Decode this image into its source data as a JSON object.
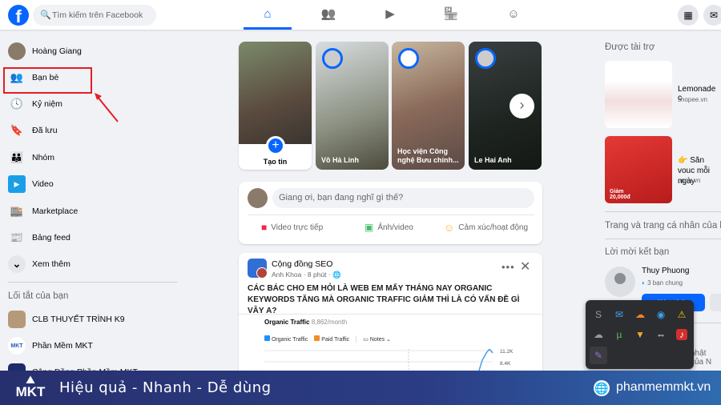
{
  "header": {
    "logo": "f",
    "search_placeholder": "Tìm kiếm trên Facebook",
    "nav": [
      {
        "icon": "home-icon",
        "glyph": "⌂",
        "active": true
      },
      {
        "icon": "friends-icon",
        "glyph": "👥"
      },
      {
        "icon": "watch-icon",
        "glyph": "▶"
      },
      {
        "icon": "marketplace-icon",
        "glyph": "🏪"
      },
      {
        "icon": "groups-icon",
        "glyph": "☺"
      }
    ],
    "menu_icon": "▦",
    "messenger_icon": "✉"
  },
  "sidebar": {
    "items": [
      {
        "label": "Hoàng Giang",
        "icon": "avatar"
      },
      {
        "label": "Bạn bè",
        "icon": "friends-icon",
        "glyph": "👥",
        "highlighted": true
      },
      {
        "label": "Kỷ niệm",
        "icon": "memories-icon",
        "glyph": "🕓"
      },
      {
        "label": "Đã lưu",
        "icon": "saved-icon",
        "glyph": "🔖"
      },
      {
        "label": "Nhóm",
        "icon": "groups-icon",
        "glyph": "👪"
      },
      {
        "label": "Video",
        "icon": "video-icon",
        "glyph": "▶"
      },
      {
        "label": "Marketplace",
        "icon": "marketplace-icon",
        "glyph": "🏬"
      },
      {
        "label": "Bảng feed",
        "icon": "feeds-icon",
        "glyph": "📰"
      },
      {
        "label": "Xem thêm",
        "icon": "chevron-down-icon",
        "glyph": "⌄"
      }
    ],
    "shortcuts_title": "Lối tắt của bạn",
    "shortcuts": [
      {
        "label": "CLB THUYẾT TRÌNH K9"
      },
      {
        "label": "Phần Mềm MKT"
      },
      {
        "label": "Cộng Đồng Phần Mềm MKT"
      }
    ]
  },
  "stories": [
    {
      "label": "Tạo tin"
    },
    {
      "label": "Võ Hà Linh"
    },
    {
      "label": "Học viện Công nghệ Bưu chính..."
    },
    {
      "label": "Le Hai Anh"
    }
  ],
  "composer": {
    "placeholder": "Giang ơi, bạn đang nghĩ gì thế?",
    "actions": [
      {
        "label": "Video trực tiếp",
        "color": "#f02849"
      },
      {
        "label": "Ảnh/video",
        "color": "#45bd62"
      },
      {
        "label": "Cảm xúc/hoạt động",
        "color": "#f7b928"
      }
    ]
  },
  "post": {
    "group": "Cộng đồng SEO",
    "author": "Anh Khoa",
    "time": "8 phút",
    "text": "CÁC BÁC CHO EM HỎI LÀ WEB EM MẤY THÁNG NAY ORGANIC KEYWORDS TĂNG MÀ ORGANIC TRAFFIC GIẢM THÌ LÀ CÓ VẤN ĐỀ GÌ VẬY Ạ?",
    "chart_title": "Organic Traffic",
    "chart_value": "8,862/month",
    "legend": [
      "Organic Traffic",
      "Paid Traffic"
    ],
    "notes": "Notes",
    "ticks": [
      "11.2K",
      "8.4K"
    ]
  },
  "right": {
    "sponsored": "Được tài trợ",
    "ads": [
      {
        "title": "Lemonade c",
        "domain": "shopee.vn"
      },
      {
        "title": "👉 Săn vouc mỗi ngày",
        "domain": "oneu.vn",
        "image_text": "Giảm 20,000đ"
      }
    ],
    "pages_title": "Trang và trang cá nhân của ba",
    "requests_title": "Lời mời kết bạn",
    "request": {
      "name": "Thuy Phuong",
      "mutual": "3 bạn chung",
      "confirm": "Xác nhận"
    },
    "birthday_partial": "nhật của N"
  },
  "banner": {
    "logo": "MKT",
    "slogan": "Hiệu quả - Nhanh - Dễ dùng",
    "website": "phanmemmkt.vn"
  },
  "colors": {
    "accent": "#0866ff",
    "highlight_box": "#e41e26",
    "banner": "#27306e"
  }
}
